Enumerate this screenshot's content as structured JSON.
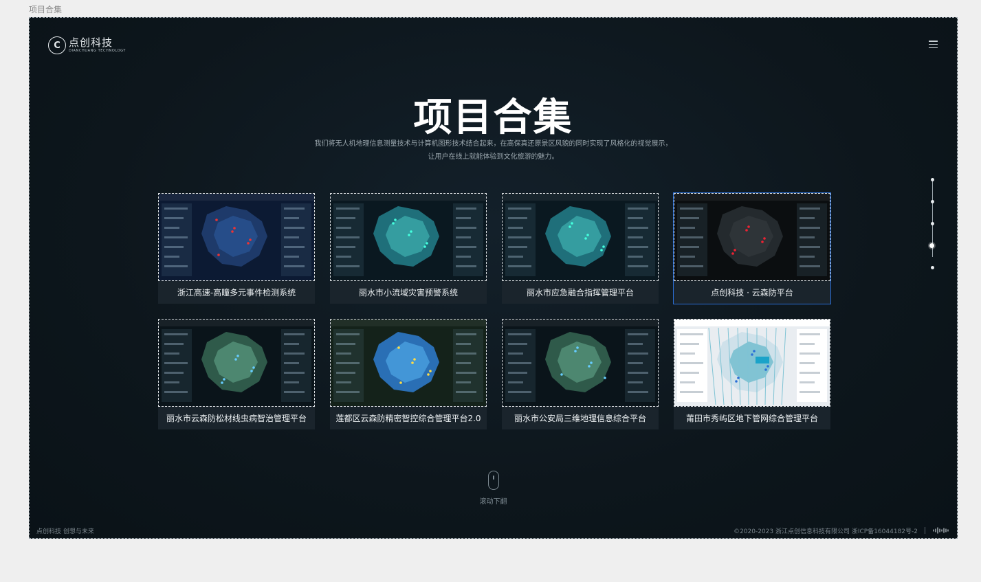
{
  "artboard_label": "项目合集",
  "header": {
    "logo_cn": "点创科技",
    "logo_en": "DIANCHUANG TECHNOLOGY",
    "logo_mark": "C",
    "menu_icon": "hamburger-menu-icon"
  },
  "hero": {
    "title": "项目合集",
    "desc_line1": "我们将无人机地理信息测量技术与计算机图形技术结合起来，在高保真还原景区风貌的同时实现了风格化的视觉展示，",
    "desc_line2": "让用户在线上就能体验到文化旅游的魅力。"
  },
  "projects": [
    {
      "title": "浙江高速-高瞳多元事件检测系统",
      "theme": "blue-dashboard"
    },
    {
      "title": "丽水市小流域灾害预警系统",
      "theme": "teal-terrain"
    },
    {
      "title": "丽水市应急融合指挥管理平台",
      "theme": "teal-terrain"
    },
    {
      "title": "点创科技 · 云森防平台",
      "theme": "dark-map",
      "active": true
    },
    {
      "title": "丽水市云森防松材线虫病智治管理平台",
      "theme": "green-terrain"
    },
    {
      "title": "莲都区云森防精密智控综合管理平台2.0",
      "theme": "blue-terrain"
    },
    {
      "title": "丽水市公安局三维地理信息综合平台",
      "theme": "green-terrain"
    },
    {
      "title": "莆田市秀屿区地下管网综合管理平台",
      "theme": "light-map"
    }
  ],
  "pager": {
    "count": 5,
    "active_index": 3
  },
  "scroll_hint": "滚动下翻",
  "footer": {
    "slogan": "点创科技 创想与未来",
    "copyright": "©2020-2023 浙江点创信息科技有限公司 浙ICP备16044182号-2",
    "sound_icon": "sound-wave-icon"
  },
  "colors": {
    "background": "#0d161c",
    "active_border": "#2b6fd6",
    "caption_bg": "#1a242c"
  }
}
